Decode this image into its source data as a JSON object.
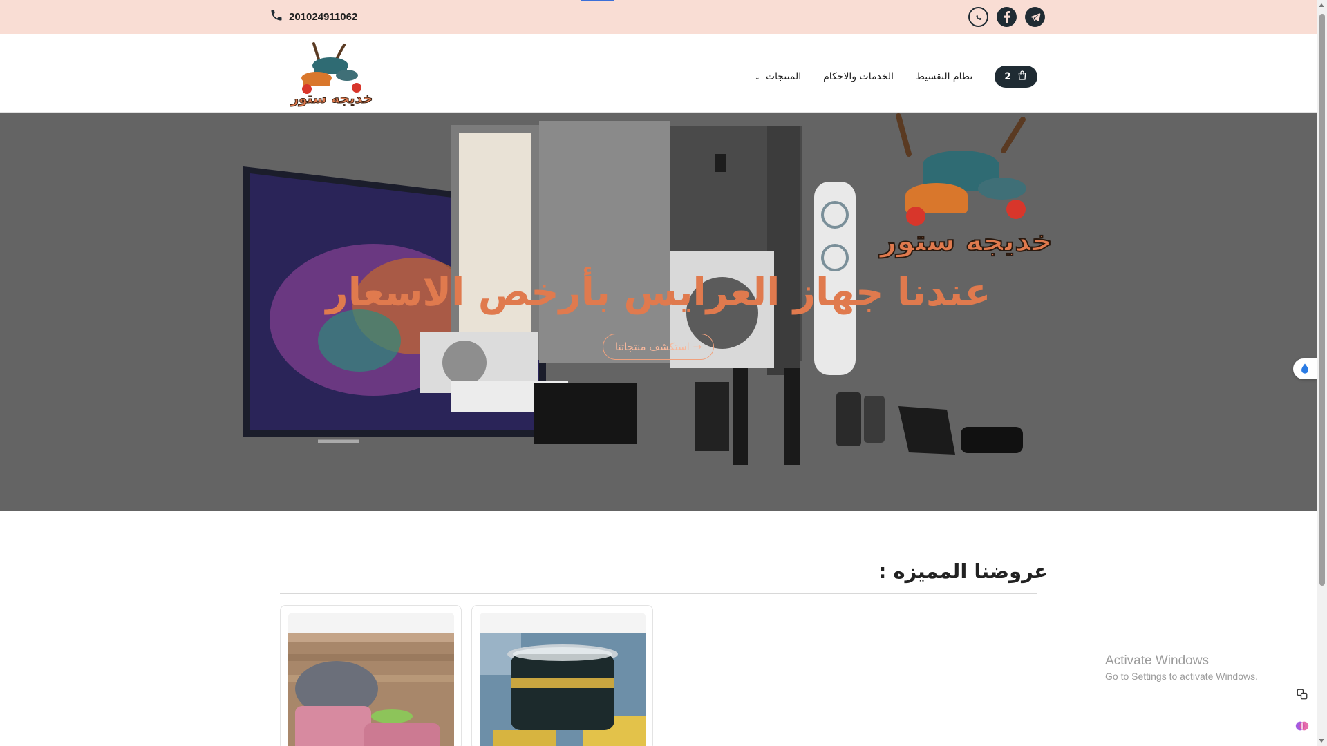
{
  "topbar": {
    "phone": "201024911062",
    "socials": [
      {
        "icon": "whatsapp-icon"
      },
      {
        "icon": "facebook-icon"
      },
      {
        "icon": "telegram-icon"
      }
    ]
  },
  "header": {
    "logo_text": "خديجه ستور",
    "cart_count": "2",
    "nav": [
      {
        "label": "نظام التقسيط"
      },
      {
        "label": "الخدمات والاحكام"
      },
      {
        "label": "المنتجات",
        "chevron": "⌄"
      }
    ]
  },
  "hero": {
    "logo_text": "خديجه ستور",
    "title": "عندنا جهاز العرايس بأرخص الاسعار",
    "button": "→ استكشف منتجاتنا"
  },
  "featured": {
    "title": "عروضنا المميزه :"
  },
  "windows": {
    "line1": "Activate Windows",
    "line2": "Go to Settings to activate Windows."
  },
  "colors": {
    "topbar_bg": "#f9ddd4",
    "accent": "#e07a4e",
    "dark": "#1f2b33"
  }
}
